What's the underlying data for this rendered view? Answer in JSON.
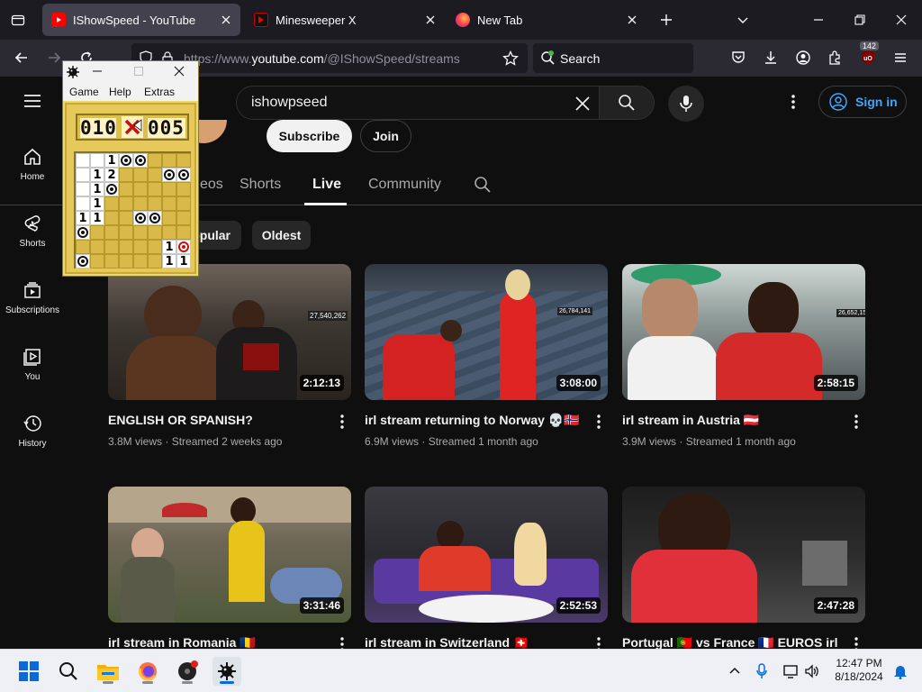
{
  "browser": {
    "tabs": [
      {
        "title": "IShowSpeed - YouTube",
        "active": true,
        "icon": "youtube-icon"
      },
      {
        "title": "Minesweeper X",
        "active": false,
        "icon": "minesweeper-icon"
      },
      {
        "title": "New Tab",
        "active": false,
        "icon": "firefox-icon"
      }
    ],
    "url_prefix": "https://www.",
    "url_domain": "youtube.com",
    "url_path": "/@IShowSpeed/streams",
    "search_placeholder": "Search",
    "badge_count": "142"
  },
  "youtube": {
    "search_value": "ishowpseed",
    "sign_in": "Sign in",
    "subscribe": "Subscribe",
    "join": "Join",
    "guide": [
      {
        "label": "Home",
        "icon": "home-icon"
      },
      {
        "label": "Shorts",
        "icon": "shorts-icon"
      },
      {
        "label": "Subscriptions",
        "icon": "subscriptions-icon"
      },
      {
        "label": "You",
        "icon": "you-icon"
      },
      {
        "label": "History",
        "icon": "history-icon"
      }
    ],
    "channel_tabs": [
      "eos",
      "Shorts",
      "Live",
      "Community"
    ],
    "selected_tab": "Live",
    "chips": [
      "opular",
      "Oldest"
    ],
    "videos": [
      {
        "title": "ENGLISH OR SPANISH?",
        "views": "3.8M views",
        "age": "Streamed 2 weeks ago",
        "duration": "2:12:13",
        "viewer_count": "27,540,262"
      },
      {
        "title": "irl stream returning to Norway 💀🇳🇴",
        "views": "6.9M views",
        "age": "Streamed 1 month ago",
        "duration": "3:08:00",
        "viewer_count": "26,784,141"
      },
      {
        "title": "irl stream in Austria 🇦🇹",
        "views": "3.9M views",
        "age": "Streamed 1 month ago",
        "duration": "2:58:15",
        "viewer_count": "26,652,156"
      },
      {
        "title": "irl stream in Romania 🇷🇴",
        "views": "",
        "age": "",
        "duration": "3:31:46",
        "viewer_count": ""
      },
      {
        "title": "irl stream in Switzerland 🇨🇭",
        "views": "",
        "age": "",
        "duration": "2:52:53",
        "viewer_count": ""
      },
      {
        "title": "Portugal 🇵🇹 vs France 🇫🇷 EUROS irl",
        "views": "",
        "age": "",
        "duration": "2:47:28",
        "viewer_count": ""
      }
    ],
    "meta_separator": "·"
  },
  "minesweeper": {
    "title_minimize": "—",
    "title_close": "✕",
    "menu": [
      "Game",
      "Help",
      "Extras"
    ],
    "mines_left": "010",
    "timer": "005",
    "grid": [
      [
        "o",
        "o",
        "1",
        "m",
        "m",
        "c",
        "c",
        "c"
      ],
      [
        "o",
        "1",
        "2",
        "c",
        "c",
        "c",
        "m",
        "m"
      ],
      [
        "o",
        "1",
        "m",
        "c",
        "c",
        "c",
        "c",
        "c"
      ],
      [
        "o",
        "1",
        "c",
        "c",
        "c",
        "c",
        "c",
        "c"
      ],
      [
        "1",
        "1",
        "c",
        "c",
        "m",
        "m",
        "c",
        "c"
      ],
      [
        "m",
        "c",
        "c",
        "c",
        "c",
        "c",
        "c",
        "c"
      ],
      [
        "c",
        "c",
        "c",
        "c",
        "c",
        "c",
        "1",
        "x"
      ],
      [
        "m",
        "c",
        "c",
        "c",
        "c",
        "c",
        "1",
        "1"
      ]
    ]
  },
  "taskbar": {
    "time": "12:47 PM",
    "date": "8/18/2024",
    "apps": [
      "start-icon",
      "search-icon",
      "file-explorer-icon",
      "firefox-icon",
      "media-player-icon",
      "minesweeper-icon"
    ]
  },
  "colors": {
    "yt_bg": "#0f0f0f",
    "accent_blue": "#3ea6ff",
    "ms_yellow": "#e6c95a"
  }
}
